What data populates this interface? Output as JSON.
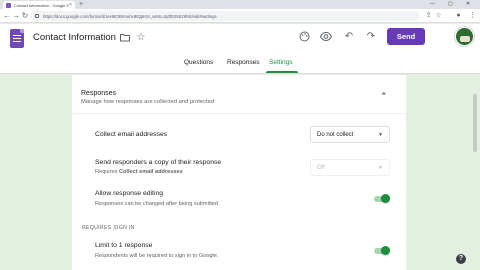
{
  "browser": {
    "tab_title": "Contact Information - Google Forms",
    "new_tab": "+",
    "tab_close": "×",
    "url": "https://docs.google.com/forms/d/1eH8OBKnuhHBQpK5I_w5SLJq0f0X5Ez9hE/edit#settings",
    "icons": [
      "back-icon",
      "forward-icon",
      "reload-icon",
      "lock-icon",
      "share-icon",
      "bookmark-star-icon",
      "profile-icon",
      "menu-icon"
    ]
  },
  "header": {
    "doc_title": "Contact Information",
    "send_label": "Send",
    "icons": [
      "folder-icon",
      "star-icon",
      "palette-icon",
      "preview-eye-icon",
      "undo-icon",
      "redo-icon"
    ]
  },
  "tabs": [
    {
      "label": "Questions"
    },
    {
      "label": "Responses"
    },
    {
      "label": "Settings",
      "active": true
    }
  ],
  "section": {
    "title": "Responses",
    "description": "Manage how responses are collected and protected"
  },
  "settings": {
    "collect_email": {
      "title": "Collect email addresses",
      "value": "Do not collect"
    },
    "send_copy": {
      "title": "Send responders a copy of their response",
      "sub_prefix": "Requires ",
      "sub_bold": "Collect email addresses",
      "value": "Off"
    },
    "allow_edit": {
      "title": "Allow response editing",
      "sub": "Responses can be changed after being submitted",
      "on": true
    },
    "group_label": "REQUIRES SIGN IN",
    "limit_one": {
      "title": "Limit to 1 response",
      "sub": "Respondents will be required to sign in to Google.",
      "on": true
    }
  },
  "colors": {
    "accent_purple": "#673ab7",
    "active_green": "#1e8e3e",
    "page_bg": "#e3f0e2"
  },
  "help": "?"
}
